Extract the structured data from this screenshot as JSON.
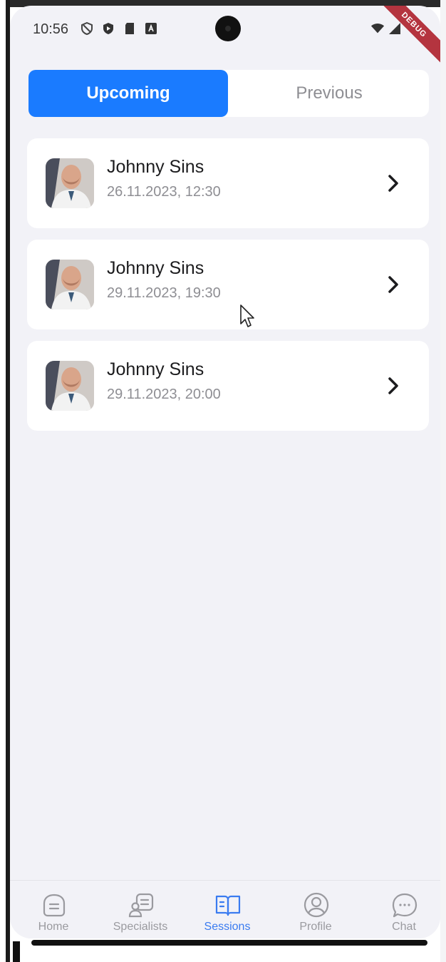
{
  "status_bar": {
    "time": "10:56"
  },
  "debug_banner": "DEBUG",
  "tabs": [
    {
      "label": "Upcoming",
      "active": true
    },
    {
      "label": "Previous",
      "active": false
    }
  ],
  "sessions": [
    {
      "name": "Johnny Sins",
      "datetime": "26.11.2023, 12:30"
    },
    {
      "name": "Johnny Sins",
      "datetime": "29.11.2023, 19:30"
    },
    {
      "name": "Johnny Sins",
      "datetime": "29.11.2023, 20:00"
    }
  ],
  "bottom_nav": [
    {
      "label": "Home",
      "icon": "home-icon",
      "active": false
    },
    {
      "label": "Specialists",
      "icon": "specialists-icon",
      "active": false
    },
    {
      "label": "Sessions",
      "icon": "book-icon",
      "active": true
    },
    {
      "label": "Profile",
      "icon": "profile-icon",
      "active": false
    },
    {
      "label": "Chat",
      "icon": "chat-icon",
      "active": false
    }
  ],
  "colors": {
    "accent": "#1a7bff",
    "background": "#f2f2f7",
    "card": "#ffffff",
    "inactive_text": "#8e8e93",
    "debug_ribbon": "#b4343f"
  }
}
